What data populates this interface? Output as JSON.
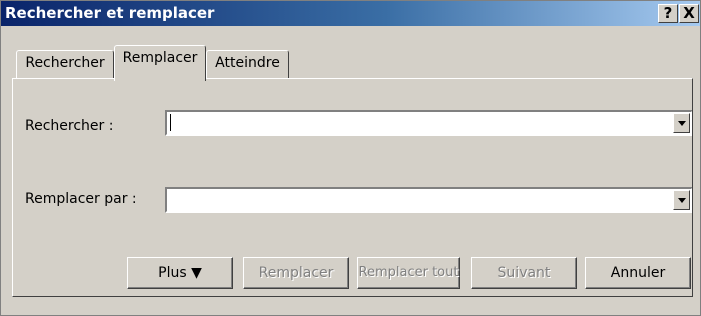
{
  "window": {
    "title": "Rechercher et remplacer",
    "help_label": "?",
    "close_label": "X"
  },
  "tabs": [
    {
      "label": "Rechercher",
      "selected": false
    },
    {
      "label": "Remplacer",
      "selected": true
    },
    {
      "label": "Atteindre",
      "selected": false
    }
  ],
  "form": {
    "find_label": "Rechercher :",
    "find_value": "",
    "replace_label": "Remplacer par :",
    "replace_value": ""
  },
  "buttons": {
    "more": "Plus ▼",
    "replace": "Remplacer",
    "replace_all": "Remplacer tout",
    "next": "Suivant",
    "cancel": "Annuler"
  },
  "colors": {
    "title_gradient_start": "#0a246a",
    "title_gradient_end": "#a6caf0",
    "face": "#d4d0c8",
    "disabled_text": "#808080"
  }
}
